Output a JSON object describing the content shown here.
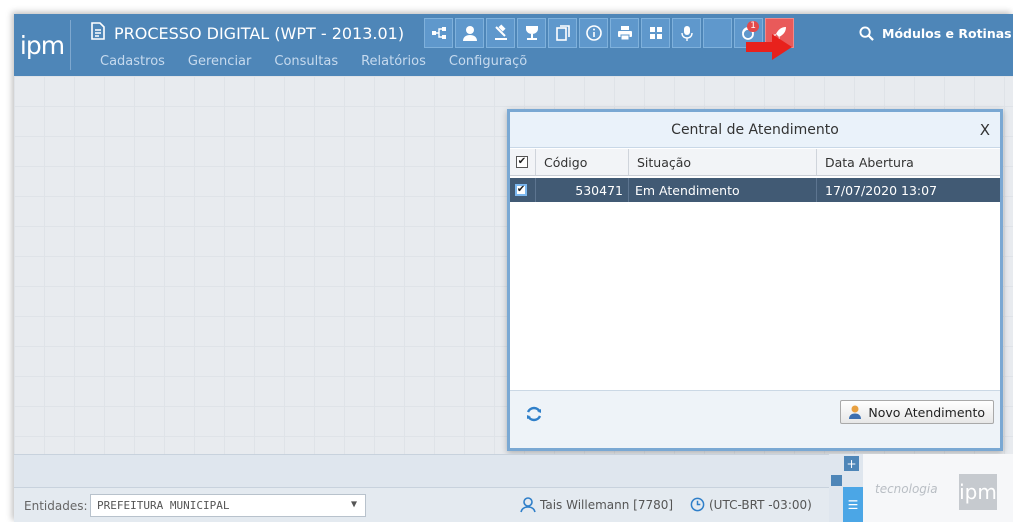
{
  "app": {
    "logo_text": "ipm",
    "title": "PROCESSO DIGITAL (WPT - 2013.01)",
    "menu": [
      "Cadastros",
      "Gerenciar",
      "Consultas",
      "Relatórios",
      "Configuraçõ"
    ],
    "modules_label": "Módulos e Rotinas",
    "notification_count": "1"
  },
  "dialog": {
    "title": "Central de Atendimento",
    "close_label": "X",
    "columns": [
      "Código",
      "Situação",
      "Data Abertura"
    ],
    "rows": [
      {
        "codigo": "530471",
        "situacao": "Em Atendimento",
        "data": "17/07/2020 13:07"
      }
    ],
    "new_button": "Novo Atendimento"
  },
  "status": {
    "entidades_label": "Entidades:",
    "entidade_value": "PREFEITURA MUNICIPAL",
    "user": "Tais Willemann [7780]",
    "timezone": "(UTC-BRT -03:00)"
  },
  "brand": {
    "text": "tecnologia",
    "logo": "ipm"
  },
  "colors": {
    "header": "#4e86b8",
    "selected_row": "#415a74",
    "rocket": "#e95a5a",
    "annotation_arrow": "#e8211c"
  },
  "icons": [
    "document-icon",
    "sitemap-icon",
    "user-icon",
    "stamp-icon",
    "award-icon",
    "files-icon",
    "info-icon",
    "printer-icon",
    "grid-icon",
    "microphone-icon",
    "support-icon",
    "rocket-icon",
    "search-icon",
    "refresh-icon",
    "person-icon",
    "clock-icon"
  ]
}
